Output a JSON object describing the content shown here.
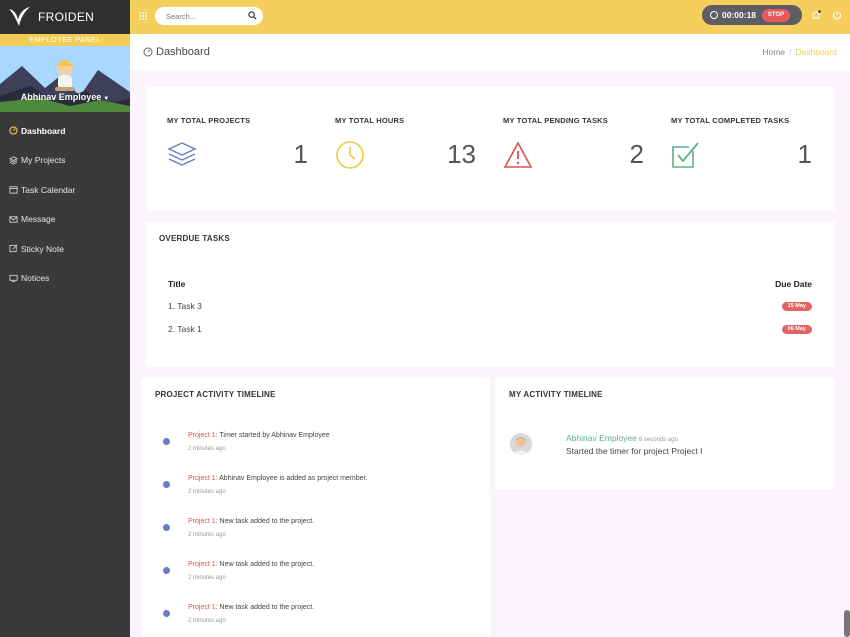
{
  "brand": {
    "name": "FROIDEN"
  },
  "sidebar": {
    "panel_label": "EMPLOYEE PANEL",
    "user_name": "Abhinav Employee",
    "items": [
      {
        "label": "Dashboard",
        "icon": "gauge-icon",
        "active": true
      },
      {
        "label": "My Projects",
        "icon": "layers-icon"
      },
      {
        "label": "Task Calendar",
        "icon": "calendar-icon"
      },
      {
        "label": "Message",
        "icon": "envelope-icon"
      },
      {
        "label": "Sticky Note",
        "icon": "note-icon"
      },
      {
        "label": "Notices",
        "icon": "monitor-icon"
      }
    ]
  },
  "topbar": {
    "search_placeholder": "Search...",
    "timer": "00:00:18",
    "stop_label": "STOP"
  },
  "header": {
    "title": "Dashboard",
    "breadcrumb": [
      "Home",
      "Dashboard"
    ]
  },
  "stats": [
    {
      "label": "MY TOTAL PROJECTS",
      "value": "1",
      "icon": "layers-icon",
      "color": "#6b7bc6"
    },
    {
      "label": "MY TOTAL HOURS",
      "value": "13",
      "icon": "clock-icon",
      "color": "#f0c93e"
    },
    {
      "label": "MY TOTAL PENDING TASKS",
      "value": "2",
      "icon": "warning-icon",
      "color": "#d9534f"
    },
    {
      "label": "MY TOTAL COMPLETED TASKS",
      "value": "1",
      "icon": "checkbox-icon",
      "color": "#5bb08a"
    }
  ],
  "overdue": {
    "title": "OVERDUE TASKS",
    "columns": [
      "Title",
      "Due Date"
    ],
    "rows": [
      {
        "title": "1. Task 3",
        "due": "15 May"
      },
      {
        "title": "2. Task 1",
        "due": "06 May"
      }
    ]
  },
  "project_timeline": {
    "title": "PROJECT ACTIVITY TIMELINE",
    "items": [
      {
        "project": "Project 1:",
        "text": " Timer started by Abhinav Employee",
        "time": "2 minutes ago"
      },
      {
        "project": "Project 1:",
        "text": " Abhinav Employee is added as project member.",
        "time": "2 minutes ago"
      },
      {
        "project": "Project 1:",
        "text": " New task added to the project.",
        "time": "2 minutes ago"
      },
      {
        "project": "Project 1:",
        "text": " New task added to the project.",
        "time": "2 minutes ago"
      },
      {
        "project": "Project 1:",
        "text": " New task added to the project.",
        "time": "2 minutes ago"
      }
    ]
  },
  "my_timeline": {
    "title": "MY ACTIVITY TIMELINE",
    "user": "Abhinav Employee",
    "ago": "6 seconds ago",
    "text": "Started the timer for project Project I"
  }
}
